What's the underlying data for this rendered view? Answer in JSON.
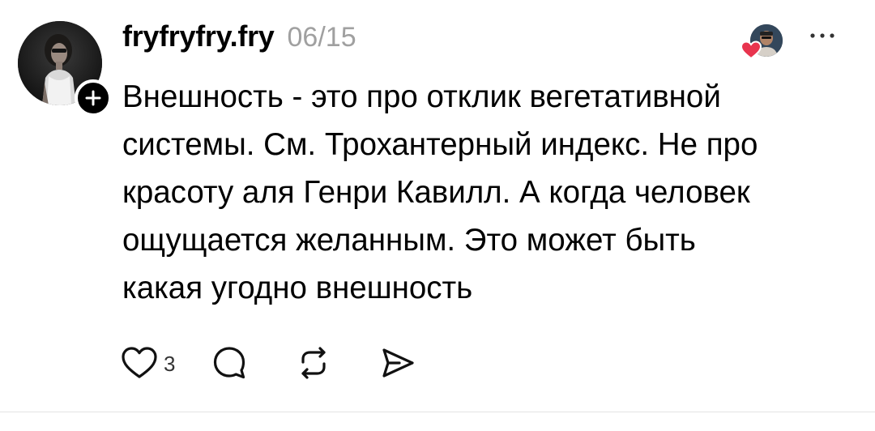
{
  "post": {
    "username": "fryfryfry.fry",
    "timestamp": "06/15",
    "text": "Внешность - это про отклик вегетативной\nсистемы. См. Трохантерный индекс. Не про\nкрасоту аля Генри Кавилл. А когда человек\nощущается желанным. Это может быть\nкакая угодно внешность",
    "like_count": "3"
  },
  "icons": {
    "follow": "plus-icon",
    "reaction": "heart-icon",
    "more": "ellipsis-icon",
    "like": "heart-outline-icon",
    "reply": "comment-icon",
    "repost": "repost-icon",
    "share": "send-icon"
  },
  "colors": {
    "text": "#000000",
    "muted": "#a0a0a0",
    "heart": "#e8344e",
    "divider": "#e3e3e3"
  }
}
